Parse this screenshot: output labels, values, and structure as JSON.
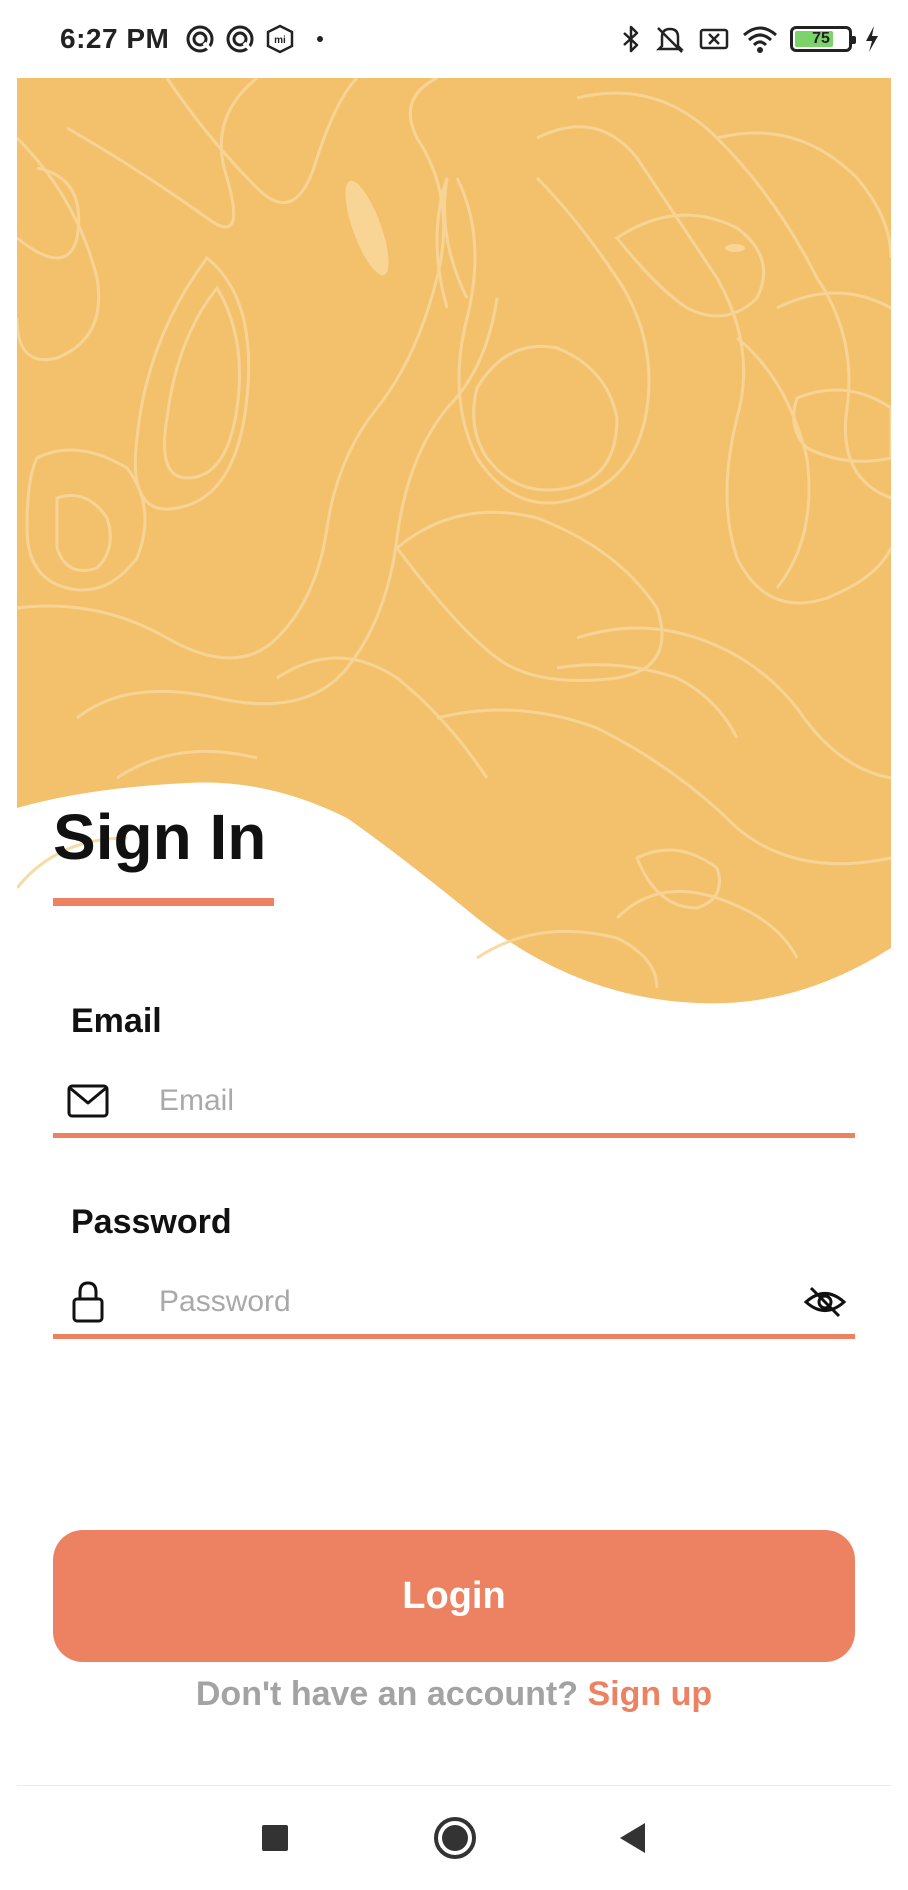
{
  "status_bar": {
    "time": "6:27 PM",
    "battery_level": "75",
    "battery_fraction": 0.75,
    "left_icons": [
      "sync-icon",
      "sync-icon",
      "mi-icon",
      "dot-icon"
    ],
    "right_icons": [
      "bluetooth-icon",
      "muted-bell-icon",
      "no-sim-icon",
      "wifi-icon",
      "battery-icon",
      "charging-icon"
    ]
  },
  "colors": {
    "accent": "#ec8262",
    "header_bg": "#f3c16c",
    "header_lines": "#f8d69a"
  },
  "signin": {
    "title": "Sign In",
    "email_label": "Email",
    "email_placeholder": "Email",
    "email_value": "",
    "password_label": "Password",
    "password_placeholder": "Password",
    "password_value": "",
    "login_label": "Login",
    "signup_prompt": "Don't have an account?",
    "signup_link": "Sign up"
  },
  "nav": [
    "recents-button",
    "home-button",
    "back-button"
  ]
}
